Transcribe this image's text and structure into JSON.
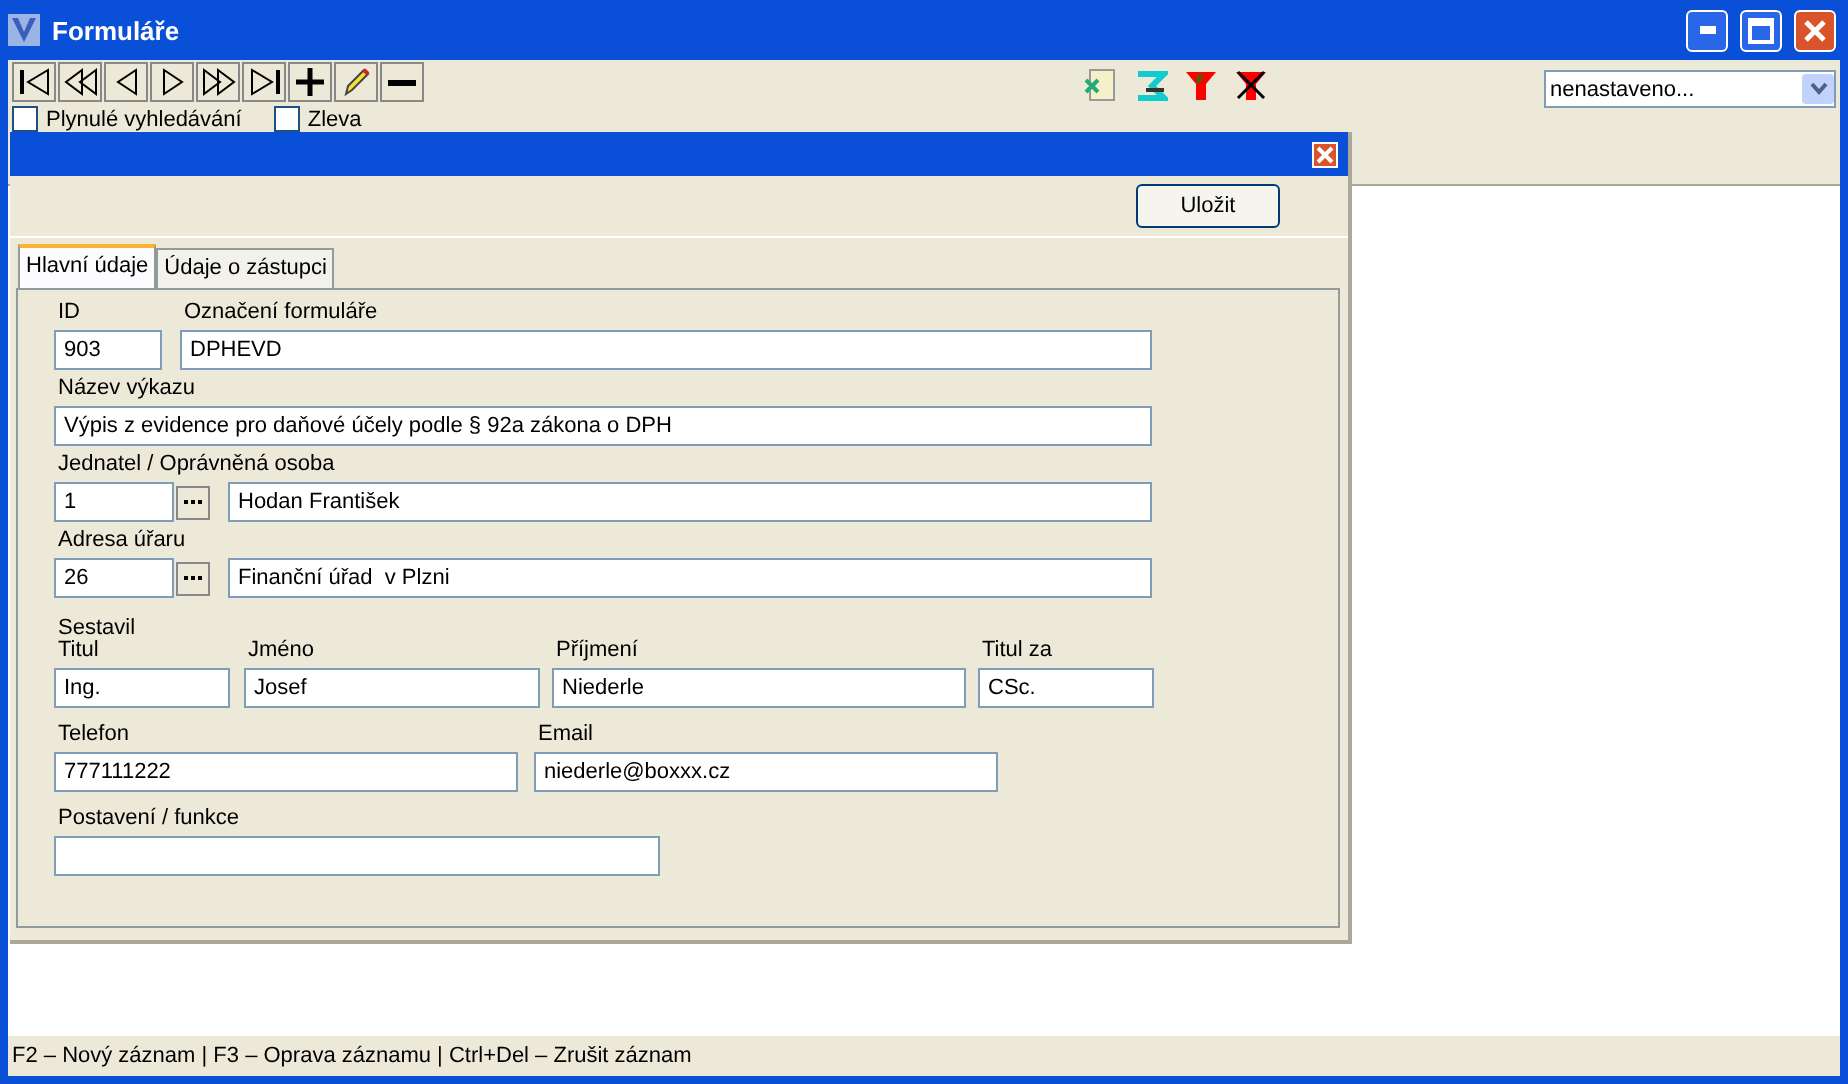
{
  "window": {
    "title": "Formuláře"
  },
  "toolbar": {
    "buttons": [
      {
        "kind": "first"
      },
      {
        "kind": "prev-page"
      },
      {
        "kind": "prev"
      },
      {
        "kind": "next"
      },
      {
        "kind": "next-page"
      },
      {
        "kind": "last"
      },
      {
        "kind": "add"
      },
      {
        "kind": "edit"
      },
      {
        "kind": "delete"
      }
    ],
    "tools": [
      {
        "kind": "export"
      },
      {
        "kind": "sum"
      },
      {
        "kind": "filter"
      },
      {
        "kind": "filter-off"
      }
    ],
    "combo": {
      "value": "nenastaveno..."
    }
  },
  "options": [
    {
      "label": "Plynulé vyhledávání",
      "checked": false
    },
    {
      "label": "Zleva",
      "checked": false
    }
  ],
  "dialog": {
    "save_button": "Uložit",
    "tabs": [
      {
        "label": "Hlavní údaje",
        "selected": true
      },
      {
        "label": "Údaje o zástupci",
        "selected": false
      }
    ],
    "rows": [
      {
        "fields": [
          {
            "kind": "text",
            "label": "ID",
            "value": "903"
          },
          {
            "kind": "text",
            "label": "Označení formuláře",
            "value": "DPHEVD"
          }
        ]
      },
      {
        "fields": [
          {
            "kind": "text",
            "label": "Název výkazu",
            "value": "Výpis z evidence pro daňové účely podle § 92a zákona o DPH"
          }
        ]
      },
      {
        "fields": [
          {
            "kind": "lookup",
            "label": "Jednatel / Oprávněná osoba",
            "value": "1"
          },
          {
            "kind": "text",
            "value": "Hodan František"
          }
        ]
      },
      {
        "fields": [
          {
            "kind": "lookup",
            "label": "Adresa úřaru",
            "value": "26"
          },
          {
            "kind": "text",
            "value": "Finanční úřad  v Plzni"
          }
        ]
      },
      {
        "group": "Sestavil",
        "fields": [
          {
            "kind": "text",
            "label": "Titul",
            "value": "Ing."
          },
          {
            "kind": "text",
            "label": "Jméno",
            "value": "Josef"
          },
          {
            "kind": "text",
            "label": "Příjmení",
            "value": "Niederle"
          },
          {
            "kind": "text",
            "label": "Titul za",
            "value": "CSc."
          }
        ]
      },
      {
        "fields": [
          {
            "kind": "text",
            "label": "Telefon",
            "value": "777111222"
          },
          {
            "kind": "text",
            "label": "Email",
            "value": "niederle@boxxx.cz"
          }
        ]
      },
      {
        "fields": [
          {
            "kind": "text",
            "label": "Postavení / funkce"
          }
        ]
      }
    ]
  },
  "status_bar": {
    "text": "F2 – Nový záznam | F3 – Oprava záznamu | Ctrl+Del – Zrušit záznam"
  }
}
